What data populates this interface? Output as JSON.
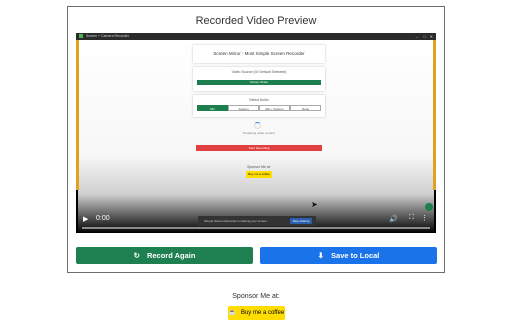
{
  "card": {
    "title": "Recorded Video Preview"
  },
  "video": {
    "inner_titlebar": "Screen + Camera Recorder",
    "inner_header": "Screen Mirror - Most Simple Screen Recorder",
    "video_source_label": "Video Source (Or Default Selected)",
    "screen_button": "Screen Share",
    "select_audio_label": "Select Audio",
    "audio_options": [
      "Mic",
      "System",
      "Mic + System",
      "None"
    ],
    "preparing_text": "Preparing video content",
    "start_button": "Start Recording",
    "inner_sponsor": "Sponsor Me at:",
    "inner_coffee": "Buy me a coffee",
    "toast_text": "Simple Screen Recorder is sharing your screen.",
    "toast_button": "Stop sharing",
    "time": "0:00",
    "progress": 0
  },
  "buttons": {
    "record_again": "Record Again",
    "save_local": "Save to Local"
  },
  "sponsor": {
    "label": "Sponsor Me at:",
    "coffee": "Buy me a coffee"
  },
  "colors": {
    "green": "#1e8050",
    "blue": "#1a73e8",
    "coffee": "#ffdd00"
  }
}
